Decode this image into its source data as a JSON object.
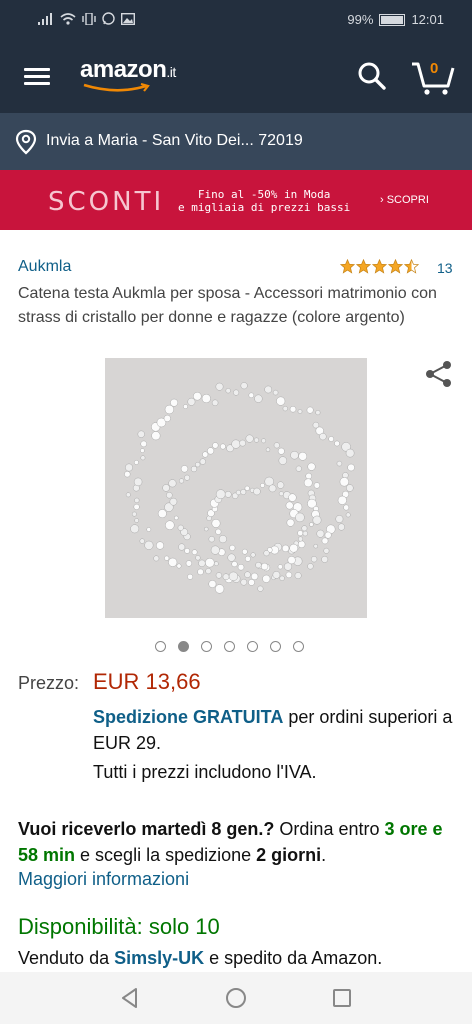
{
  "status_bar": {
    "battery_text": "99%",
    "time": "12:01",
    "battery_level": 0.99,
    "icons": [
      "signal-icon",
      "wifi-icon",
      "vibrate-icon",
      "whatsapp-icon",
      "image-icon"
    ]
  },
  "header": {
    "logo_text": "amazon",
    "logo_tld": ".it",
    "cart_count": "0",
    "accent_color": "#f08804",
    "bar_color": "#232f3e"
  },
  "delivery_bar": {
    "text": "Invia a Maria - San Vito Dei... 72019"
  },
  "promo": {
    "word": "SCONTI",
    "line1": "Fino al -50% in Moda",
    "line2": "e migliaia di prezzi bassi",
    "cta": "› SCOPRI",
    "color": "#c8143c"
  },
  "product": {
    "brand": "Aukmla",
    "rating": 4.5,
    "rating_count": "13",
    "title": "Catena testa Aukmla per sposa - Accessori matrimonio con strass di cristallo per donne e ragazze (colore argento)",
    "image_count": 7,
    "active_image": 2
  },
  "price": {
    "label": "Prezzo:",
    "value": "EUR 13,66",
    "shipping_link": "Spedizione GRATUITA",
    "shipping_rest": " per ordini superiori a EUR 29.",
    "vat_note": "Tutti i prezzi includono l'IVA."
  },
  "delivery": {
    "part1": "Vuoi riceverlo martedì 8 gen.?",
    "part2": " Ordina entro ",
    "part3": "3 ore e 58 min",
    "part4": " e scegli la spedizione ",
    "part5": "2 giorni",
    "part6": ".",
    "link": "Maggiori informazioni"
  },
  "availability": {
    "text": "Disponibilità: solo 10"
  },
  "seller": {
    "prefix": "Venduto da ",
    "name": "Simsly-UK",
    "suffix": " e spedito da Amazon."
  }
}
